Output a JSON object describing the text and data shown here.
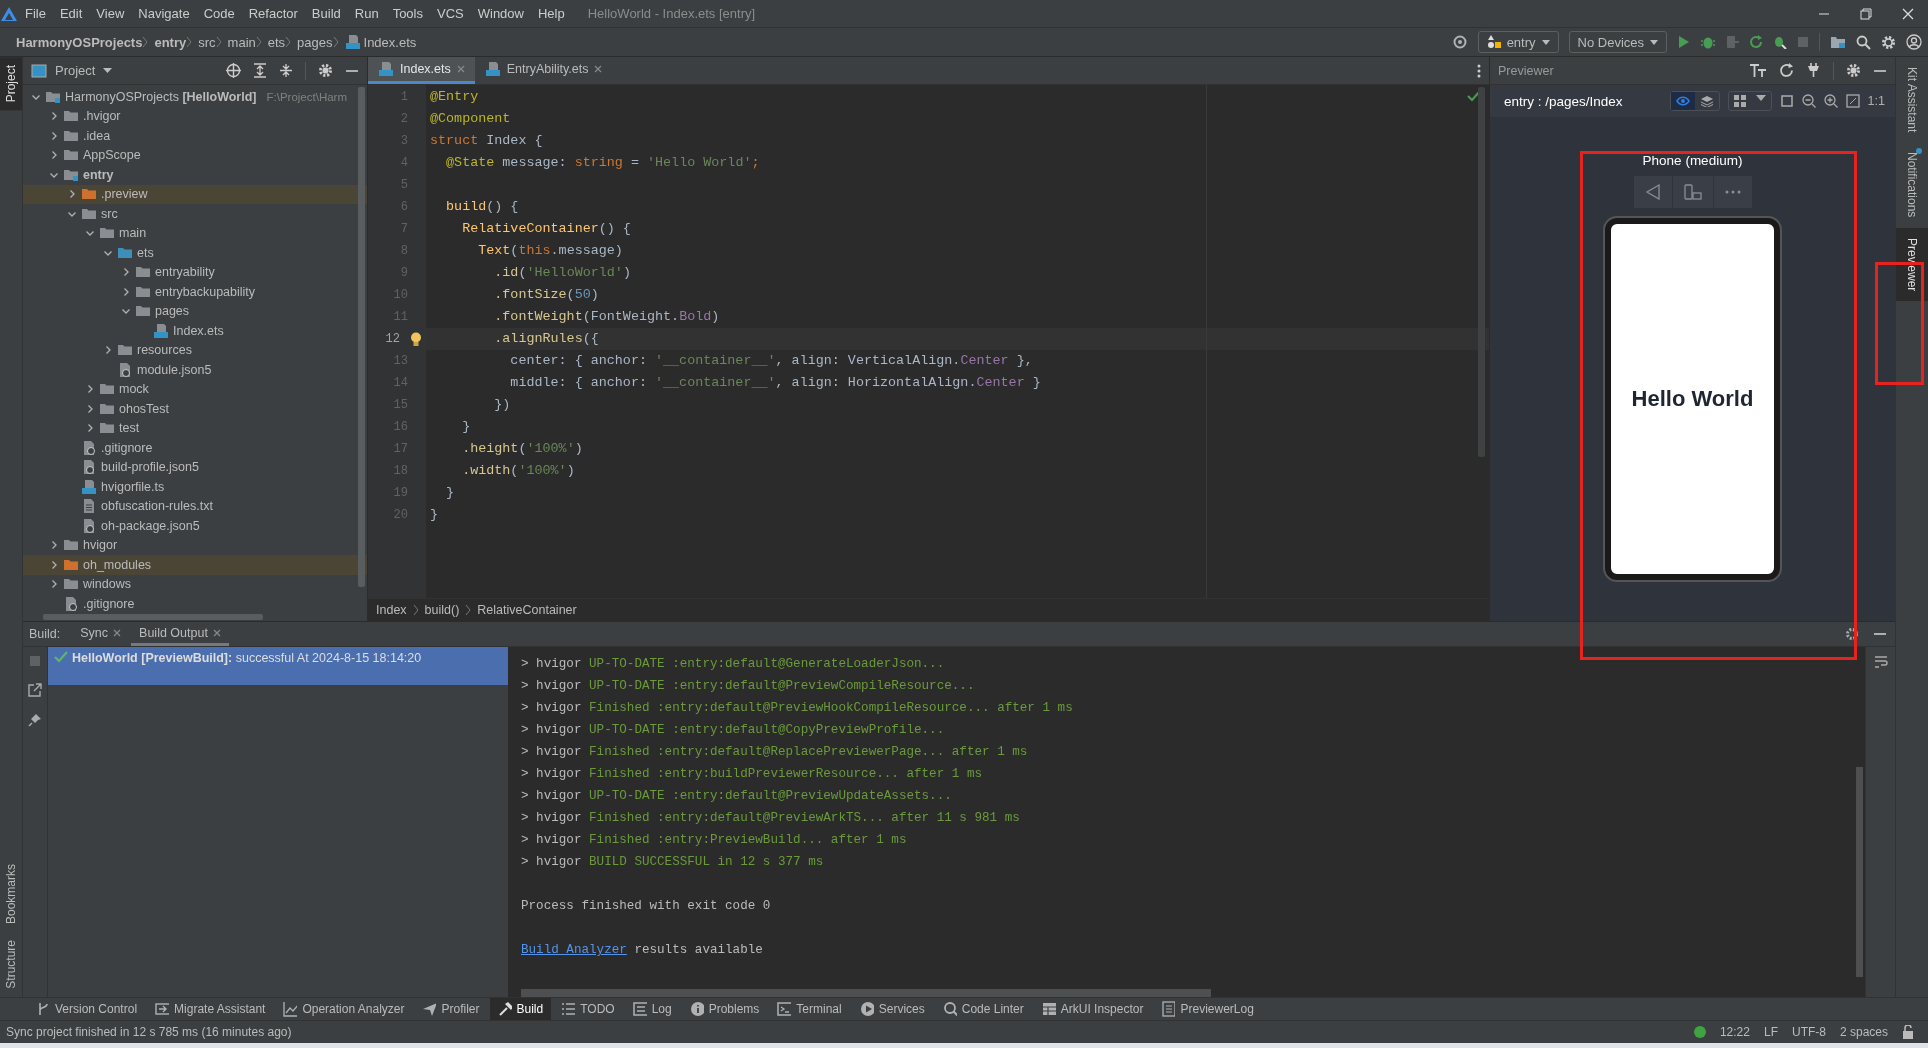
{
  "window": {
    "title": "HelloWorld - Index.ets [entry]"
  },
  "menu": [
    "File",
    "Edit",
    "View",
    "Navigate",
    "Code",
    "Refactor",
    "Build",
    "Run",
    "Tools",
    "VCS",
    "Window",
    "Help"
  ],
  "nav_path": [
    {
      "label": "HarmonyOSProjects",
      "bold": true,
      "kind": "folder"
    },
    {
      "label": "entry",
      "bold": true,
      "kind": "folder"
    },
    {
      "label": "src",
      "bold": false,
      "kind": "folder"
    },
    {
      "label": "main",
      "bold": false,
      "kind": "folder"
    },
    {
      "label": "ets",
      "bold": false,
      "kind": "folder"
    },
    {
      "label": "pages",
      "bold": false,
      "kind": "folder"
    },
    {
      "label": "Index.ets",
      "bold": false,
      "kind": "ets-file"
    }
  ],
  "toolbar": {
    "module": "entry",
    "device": "No Devices"
  },
  "left_stripe_top": [
    {
      "label": "Project",
      "selected": true
    }
  ],
  "left_stripe_bottom": [
    {
      "label": "Bookmarks",
      "selected": false
    },
    {
      "label": "Structure",
      "selected": false
    }
  ],
  "project_panel": {
    "title": "Project",
    "tree": [
      {
        "name": "HarmonyOSProjects",
        "tag": "[HelloWorld]",
        "path": "F:\\Project\\Harm",
        "kind": "project",
        "expanded": true,
        "children": [
          {
            "name": ".hvigor",
            "kind": "folder",
            "expanded": false
          },
          {
            "name": ".idea",
            "kind": "folder",
            "expanded": false
          },
          {
            "name": "AppScope",
            "kind": "folder",
            "expanded": false
          },
          {
            "name": "entry",
            "kind": "module",
            "expanded": true,
            "children": [
              {
                "name": ".preview",
                "kind": "excluded-folder",
                "expanded": false
              },
              {
                "name": "src",
                "kind": "folder",
                "expanded": true,
                "children": [
                  {
                    "name": "main",
                    "kind": "folder",
                    "expanded": true,
                    "children": [
                      {
                        "name": "ets",
                        "kind": "source-folder",
                        "expanded": true,
                        "children": [
                          {
                            "name": "entryability",
                            "kind": "folder",
                            "expanded": false
                          },
                          {
                            "name": "entrybackupability",
                            "kind": "folder",
                            "expanded": false
                          },
                          {
                            "name": "pages",
                            "kind": "folder",
                            "expanded": true,
                            "children": [
                              {
                                "name": "Index.ets",
                                "kind": "ets-file"
                              }
                            ]
                          }
                        ]
                      },
                      {
                        "name": "resources",
                        "kind": "folder",
                        "expanded": false
                      },
                      {
                        "name": "module.json5",
                        "kind": "json-file"
                      }
                    ]
                  },
                  {
                    "name": "mock",
                    "kind": "folder",
                    "expanded": false
                  },
                  {
                    "name": "ohosTest",
                    "kind": "folder",
                    "expanded": false
                  },
                  {
                    "name": "test",
                    "kind": "folder",
                    "expanded": false
                  }
                ]
              },
              {
                "name": ".gitignore",
                "kind": "ignore-file"
              },
              {
                "name": "build-profile.json5",
                "kind": "json-file"
              },
              {
                "name": "hvigorfile.ts",
                "kind": "ts-file"
              },
              {
                "name": "obfuscation-rules.txt",
                "kind": "text-file"
              },
              {
                "name": "oh-package.json5",
                "kind": "json-file"
              }
            ]
          },
          {
            "name": "hvigor",
            "kind": "folder",
            "expanded": false
          },
          {
            "name": "oh_modules",
            "kind": "excluded-folder",
            "expanded": false
          },
          {
            "name": "windows",
            "kind": "folder",
            "expanded": false
          },
          {
            "name": ".gitignore",
            "kind": "ignore-file"
          }
        ]
      }
    ]
  },
  "editor": {
    "tabs": [
      {
        "label": "Index.ets",
        "selected": true
      },
      {
        "label": "EntryAbility.ets",
        "selected": false
      }
    ],
    "lines": [
      {
        "number": "1",
        "current": false,
        "tokens": [
          {
            "text": "@Entry",
            "kind": "ann"
          }
        ]
      },
      {
        "number": "2",
        "current": false,
        "tokens": [
          {
            "text": "@Component",
            "kind": "ann"
          }
        ]
      },
      {
        "number": "3",
        "current": false,
        "tokens": [
          {
            "text": "struct ",
            "kind": "kw"
          },
          {
            "text": "Index",
            "kind": "type"
          },
          {
            "text": " {",
            "kind": "plain"
          }
        ]
      },
      {
        "number": "4",
        "current": false,
        "tokens": [
          {
            "text": "  @State",
            "kind": "ann"
          },
          {
            "text": " message: ",
            "kind": "plain"
          },
          {
            "text": "string",
            "kind": "kw"
          },
          {
            "text": " = ",
            "kind": "plain"
          },
          {
            "text": "'Hello World'",
            "kind": "str"
          },
          {
            "text": ";",
            "kind": "kw"
          }
        ]
      },
      {
        "number": "5",
        "current": false
      },
      {
        "number": "6",
        "current": false,
        "tokens": [
          {
            "text": "  build",
            "kind": "fn"
          },
          {
            "text": "() {",
            "kind": "plain"
          }
        ]
      },
      {
        "number": "7",
        "current": false,
        "tokens": [
          {
            "text": "    RelativeContainer",
            "kind": "fn"
          },
          {
            "text": "() {",
            "kind": "plain"
          }
        ]
      },
      {
        "number": "8",
        "current": false,
        "tokens": [
          {
            "text": "      Text",
            "kind": "fn"
          },
          {
            "text": "(",
            "kind": "plain"
          },
          {
            "text": "this",
            "kind": "kw"
          },
          {
            "text": ".message)",
            "kind": "plain"
          }
        ]
      },
      {
        "number": "9",
        "current": false,
        "tokens": [
          {
            "text": "        .id",
            "kind": "method"
          },
          {
            "text": "(",
            "kind": "plain"
          },
          {
            "text": "'HelloWorld'",
            "kind": "str"
          },
          {
            "text": ")",
            "kind": "plain"
          }
        ]
      },
      {
        "number": "10",
        "current": false,
        "tokens": [
          {
            "text": "        .fontSize",
            "kind": "method"
          },
          {
            "text": "(",
            "kind": "plain"
          },
          {
            "text": "50",
            "kind": "num"
          },
          {
            "text": ")",
            "kind": "plain"
          }
        ]
      },
      {
        "number": "11",
        "current": false,
        "tokens": [
          {
            "text": "        .fontWeight",
            "kind": "method"
          },
          {
            "text": "(FontWeight.",
            "kind": "plain"
          },
          {
            "text": "Bold",
            "kind": "field"
          },
          {
            "text": ")",
            "kind": "plain"
          }
        ]
      },
      {
        "number": "12",
        "current": true,
        "tokens": [
          {
            "text": "        .alignRules",
            "kind": "method"
          },
          {
            "text": "({",
            "kind": "plain"
          }
        ]
      },
      {
        "number": "13",
        "current": false,
        "tokens": [
          {
            "text": "          center: { anchor: ",
            "kind": "plain"
          },
          {
            "text": "'__container__'",
            "kind": "str"
          },
          {
            "text": ", align: VerticalAlign.",
            "kind": "plain"
          },
          {
            "text": "Center",
            "kind": "field"
          },
          {
            "text": " },",
            "kind": "plain"
          }
        ]
      },
      {
        "number": "14",
        "current": false,
        "tokens": [
          {
            "text": "          middle: { anchor: ",
            "kind": "plain"
          },
          {
            "text": "'__container__'",
            "kind": "str"
          },
          {
            "text": ", align: HorizontalAlign.",
            "kind": "plain"
          },
          {
            "text": "Center",
            "kind": "field"
          },
          {
            "text": " }",
            "kind": "plain"
          }
        ]
      },
      {
        "number": "15",
        "current": false,
        "tokens": [
          {
            "text": "        })",
            "kind": "plain"
          }
        ]
      },
      {
        "number": "16",
        "current": false,
        "tokens": [
          {
            "text": "    }",
            "kind": "plain"
          }
        ]
      },
      {
        "number": "17",
        "current": false,
        "tokens": [
          {
            "text": "    .height",
            "kind": "method"
          },
          {
            "text": "(",
            "kind": "plain"
          },
          {
            "text": "'100%'",
            "kind": "str"
          },
          {
            "text": ")",
            "kind": "plain"
          }
        ]
      },
      {
        "number": "18",
        "current": false,
        "tokens": [
          {
            "text": "    .width",
            "kind": "method"
          },
          {
            "text": "(",
            "kind": "plain"
          },
          {
            "text": "'100%'",
            "kind": "str"
          },
          {
            "text": ")",
            "kind": "plain"
          }
        ]
      },
      {
        "number": "19",
        "current": false,
        "tokens": [
          {
            "text": "  }",
            "kind": "plain"
          }
        ]
      },
      {
        "number": "20",
        "current": false,
        "tokens": [
          {
            "text": "}",
            "kind": "plain"
          }
        ]
      }
    ],
    "breadcrumb": [
      "Index",
      "build()",
      "RelativeContainer"
    ]
  },
  "previewer": {
    "title": "Previewer",
    "page": "entry : /pages/Index",
    "zoom_reset": "1:1",
    "device": "Phone (medium)",
    "screen_text": "Hello World"
  },
  "right_stripe": [
    {
      "label": "Kit Assistant",
      "selected": false,
      "badge": false
    },
    {
      "label": "Notifications",
      "selected": false,
      "badge": true
    },
    {
      "label": "Previewer",
      "selected": true,
      "badge": false
    }
  ],
  "build": {
    "label": "Build:",
    "tabs": [
      {
        "label": "Sync",
        "selected": false
      },
      {
        "label": "Build Output",
        "selected": true
      }
    ],
    "tasks": [
      {
        "kind": "success",
        "text": "**HelloWorld [PreviewBuild]:** successful At 2024-8-15 18:14:20",
        "selected": true
      }
    ],
    "log": [
      {
        "prefix": "> hvigor",
        "text": "UP-TO-DATE :entry:default@GenerateLoaderJson..."
      },
      {
        "prefix": "> hvigor",
        "text": "UP-TO-DATE :entry:default@PreviewCompileResource..."
      },
      {
        "prefix": "> hvigor",
        "text": "Finished :entry:default@PreviewHookCompileResource... after 1 ms"
      },
      {
        "prefix": "> hvigor",
        "text": "UP-TO-DATE :entry:default@CopyPreviewProfile..."
      },
      {
        "prefix": "> hvigor",
        "text": "Finished :entry:default@ReplacePreviewerPage... after 1 ms"
      },
      {
        "prefix": "> hvigor",
        "text": "Finished :entry:buildPreviewerResource... after 1 ms"
      },
      {
        "prefix": "> hvigor",
        "text": "UP-TO-DATE :entry:default@PreviewUpdateAssets..."
      },
      {
        "prefix": "> hvigor",
        "text": "Finished :entry:default@PreviewArkTS... after 11 s 981 ms"
      },
      {
        "prefix": "> hvigor",
        "text": "Finished :entry:PreviewBuild... after 1 ms"
      },
      {
        "prefix": "> hvigor",
        "text": "BUILD SUCCESSFUL in 12 s 377 ms"
      }
    ],
    "exit_message": "Process finished with exit code 0",
    "analyzer": {
      "link": "Build Analyzer",
      "text": "results available"
    }
  },
  "tool_windows": [
    {
      "label": "Version Control",
      "selected": false
    },
    {
      "label": "Migrate Assistant",
      "selected": false
    },
    {
      "label": "Operation Analyzer",
      "selected": false
    },
    {
      "label": "Profiler",
      "selected": false
    },
    {
      "label": "Build",
      "selected": true
    },
    {
      "label": "TODO",
      "selected": false
    },
    {
      "label": "Log",
      "selected": false
    },
    {
      "label": "Problems",
      "selected": false
    },
    {
      "label": "Terminal",
      "selected": false
    },
    {
      "label": "Services",
      "selected": false
    },
    {
      "label": "Code Linter",
      "selected": false
    },
    {
      "label": "ArkUI Inspector",
      "selected": false
    },
    {
      "label": "PreviewerLog",
      "selected": false
    }
  ],
  "status_bar": {
    "message": "Sync project finished in 12 s 785 ms (16 minutes ago)",
    "position": "12:22",
    "line_separator": "LF",
    "encoding": "UTF-8",
    "indent": "2 spaces"
  }
}
